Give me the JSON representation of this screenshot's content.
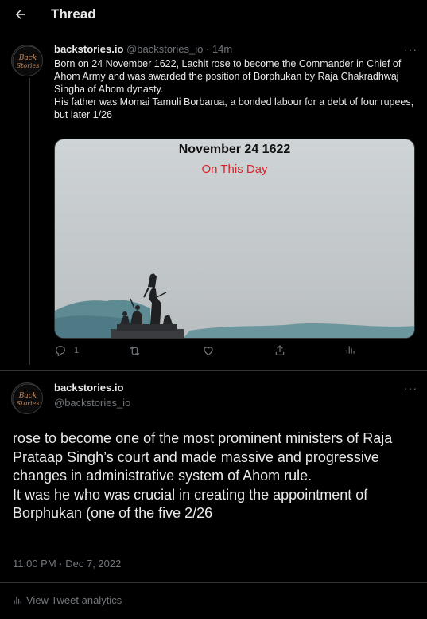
{
  "header": {
    "title": "Thread",
    "back_icon": "arrow-left-icon"
  },
  "colors": {
    "background": "#000000",
    "text": "#e7e9ea",
    "muted": "#71767b",
    "divider": "#2f3336",
    "accent_red": "#d8232a"
  },
  "tweet1": {
    "name": "backstories.io",
    "handle": "@backstories_io",
    "time": "· 14m",
    "more": "···",
    "avatar_text": "Back Stories",
    "text_lines": [
      "Born on 24 November 1622, Lachit rose to become the Commander in Chief of Ahom Army and was awarded the position of Borphukan by Raja Chakradhwaj Singha of Ahom dynasty.",
      "His father was Momai Tamuli Borbarua, a bonded labour for a debt of four rupees, but later 1/26"
    ],
    "media": {
      "title": "November 24 1622",
      "subtitle": "On This Day"
    },
    "actions": {
      "reply_count": "1",
      "retweet_count": "",
      "like_count": ""
    }
  },
  "tweet2": {
    "name": "backstories.io",
    "handle": "@backstories_io",
    "more": "···",
    "text_lines": [
      "rose to become one of the most prominent ministers of Raja Prataap Singh’s court and made massive and progressive changes in administrative system of Ahom rule.",
      "It was he who was crucial in creating the appointment of Borphukan (one of the five 2/26"
    ],
    "timestamp": "11:00 PM · Dec 7, 2022",
    "analytics_label": "View Tweet analytics"
  }
}
